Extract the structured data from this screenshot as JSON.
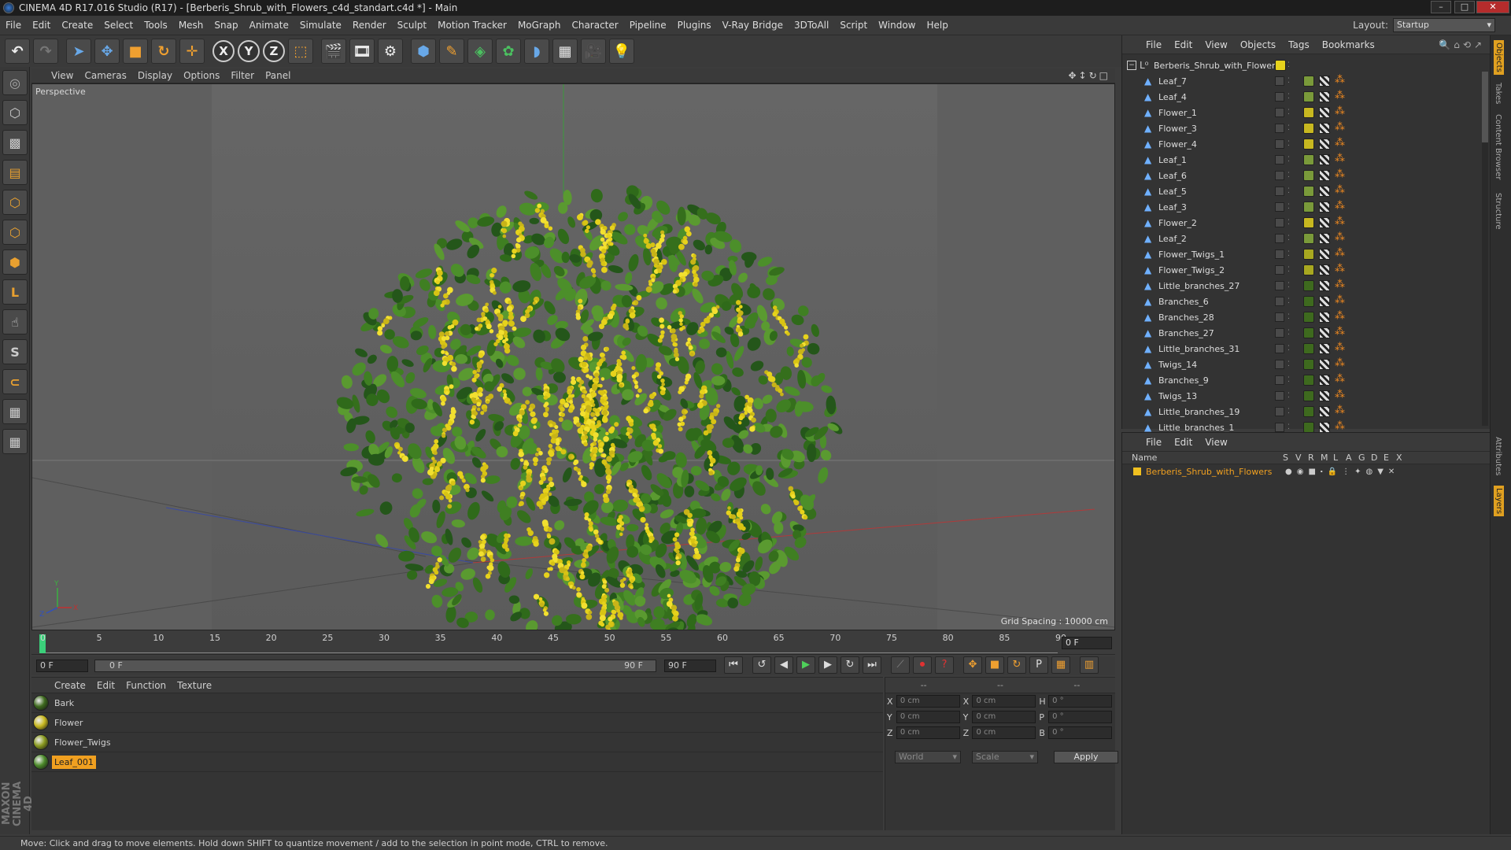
{
  "title": "CINEMA 4D R17.016 Studio (R17) - [Berberis_Shrub_with_Flowers_c4d_standart.c4d *] - Main",
  "menu": [
    "File",
    "Edit",
    "Create",
    "Select",
    "Tools",
    "Mesh",
    "Snap",
    "Animate",
    "Simulate",
    "Render",
    "Sculpt",
    "Motion Tracker",
    "MoGraph",
    "Character",
    "Pipeline",
    "Plugins",
    "V-Ray Bridge",
    "3DToAll",
    "Script",
    "Window",
    "Help"
  ],
  "layout": {
    "label": "Layout:",
    "value": "Startup"
  },
  "viewport": {
    "menu": [
      "View",
      "Cameras",
      "Display",
      "Options",
      "Filter",
      "Panel"
    ],
    "label": "Perspective",
    "grid_spacing": "Grid Spacing : 10000 cm"
  },
  "timeline": {
    "ticks": [
      "0",
      "5",
      "10",
      "15",
      "20",
      "25",
      "30",
      "35",
      "40",
      "45",
      "50",
      "55",
      "60",
      "65",
      "70",
      "75",
      "80",
      "85",
      "90"
    ],
    "frame_box": "0 F",
    "start_field": "0 F",
    "slider_left": "0 F",
    "slider_right": "90 F",
    "end_field": "90 F"
  },
  "material_manager": {
    "menu": [
      "Create",
      "Edit",
      "Function",
      "Texture"
    ],
    "materials": [
      {
        "name": "Bark",
        "color": "#3e6a1e"
      },
      {
        "name": "Flower",
        "color": "#c8b820"
      },
      {
        "name": "Flower_Twigs",
        "color": "#8a9a20"
      },
      {
        "name": "Leaf_001",
        "color": "#4c8a2a"
      }
    ],
    "selected": "Leaf_001"
  },
  "coords": {
    "head": [
      "--",
      "--",
      "--"
    ],
    "rows": [
      {
        "a": "X",
        "av": "0 cm",
        "b": "X",
        "bv": "0 cm",
        "c": "H",
        "cv": "0 °"
      },
      {
        "a": "Y",
        "av": "0 cm",
        "b": "Y",
        "bv": "0 cm",
        "c": "P",
        "cv": "0 °"
      },
      {
        "a": "Z",
        "av": "0 cm",
        "b": "Z",
        "bv": "0 cm",
        "c": "B",
        "cv": "0 °"
      }
    ],
    "world": "World",
    "scale": "Scale",
    "apply": "Apply"
  },
  "object_manager": {
    "menu": [
      "File",
      "Edit",
      "View",
      "Objects",
      "Tags",
      "Bookmarks"
    ],
    "root": "Berberis_Shrub_with_Flowers",
    "objects": [
      {
        "name": "Leaf_7",
        "tag": "#7a9a3a"
      },
      {
        "name": "Leaf_4",
        "tag": "#7a9a3a"
      },
      {
        "name": "Flower_1",
        "tag": "#c8b820"
      },
      {
        "name": "Flower_3",
        "tag": "#c8b820"
      },
      {
        "name": "Flower_4",
        "tag": "#c8b820"
      },
      {
        "name": "Leaf_1",
        "tag": "#7a9a3a"
      },
      {
        "name": "Leaf_6",
        "tag": "#7a9a3a"
      },
      {
        "name": "Leaf_5",
        "tag": "#7a9a3a"
      },
      {
        "name": "Leaf_3",
        "tag": "#7a9a3a"
      },
      {
        "name": "Flower_2",
        "tag": "#c8b820"
      },
      {
        "name": "Leaf_2",
        "tag": "#7a9a3a"
      },
      {
        "name": "Flower_Twigs_1",
        "tag": "#a8a820"
      },
      {
        "name": "Flower_Twigs_2",
        "tag": "#a8a820"
      },
      {
        "name": "Little_branches_27",
        "tag": "#3e6a1e"
      },
      {
        "name": "Branches_6",
        "tag": "#3e6a1e"
      },
      {
        "name": "Branches_28",
        "tag": "#3e6a1e"
      },
      {
        "name": "Branches_27",
        "tag": "#3e6a1e"
      },
      {
        "name": "Little_branches_31",
        "tag": "#3e6a1e"
      },
      {
        "name": "Twigs_14",
        "tag": "#3e6a1e"
      },
      {
        "name": "Branches_9",
        "tag": "#3e6a1e"
      },
      {
        "name": "Twigs_13",
        "tag": "#3e6a1e"
      },
      {
        "name": "Little_branches_19",
        "tag": "#3e6a1e"
      },
      {
        "name": "Little_branches_1",
        "tag": "#3e6a1e"
      }
    ]
  },
  "layer_manager": {
    "menu": [
      "File",
      "Edit",
      "View"
    ],
    "header_name": "Name",
    "columns": [
      "S",
      "V",
      "R",
      "M",
      "L",
      "A",
      "G",
      "D",
      "E",
      "X"
    ],
    "layer": "Berberis_Shrub_with_Flowers"
  },
  "right_tabs": [
    "Objects",
    "Takes",
    "Content Browser",
    "Structure",
    "Attributes",
    "Layers"
  ],
  "brand": "MAXON CINEMA 4D",
  "status": "Move: Click and drag to move elements. Hold down SHIFT to quantize movement / add to the selection in point mode, CTRL to remove.",
  "colors": {
    "accent": "#f0a020",
    "leaf": "#3f7f22",
    "flower": "#e6d21c"
  }
}
